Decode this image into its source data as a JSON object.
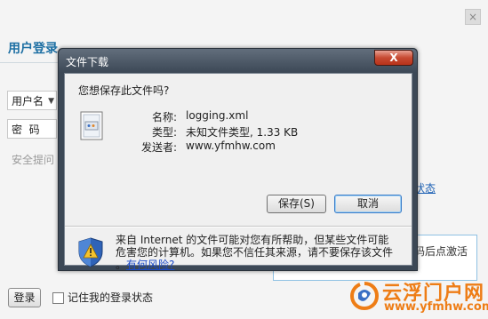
{
  "login_page": {
    "title": "用户登录",
    "username_label": "用户名",
    "password_label": "密  码",
    "security_question_label": "安全提问",
    "right_link": "状态",
    "info_box_text": "码后点激活",
    "login_button": "登录",
    "remember_label": "记住我的登录状态",
    "close_glyph": "×"
  },
  "watermark": {
    "name": "云浮门户网",
    "url": "www.yfmhw.com"
  },
  "dialog": {
    "title": "文件下载",
    "close_glyph": "X",
    "question": "您想保存此文件吗?",
    "info": [
      {
        "label": "名称:",
        "value": "logging.xml"
      },
      {
        "label": "类型:",
        "value": "未知文件类型, 1.33 KB"
      },
      {
        "label": "发送者:",
        "value": "www.yfmhw.com"
      }
    ],
    "save_button": "保存(S)",
    "cancel_button": "取消",
    "warning_line1": "来自 Internet 的文件可能对您有所帮助，但某些文件可能",
    "warning_line2": "危害您的计算机。如果您不信任其来源，请不要保存该文件",
    "warning_line3_prefix": "。",
    "risk_link": "有何风险?"
  },
  "colors": {
    "title_blue": "#1d6fa3",
    "watermark_orange": "#ee7d16",
    "link_blue": "#1a4ac8",
    "close_red": "#c74a32"
  }
}
